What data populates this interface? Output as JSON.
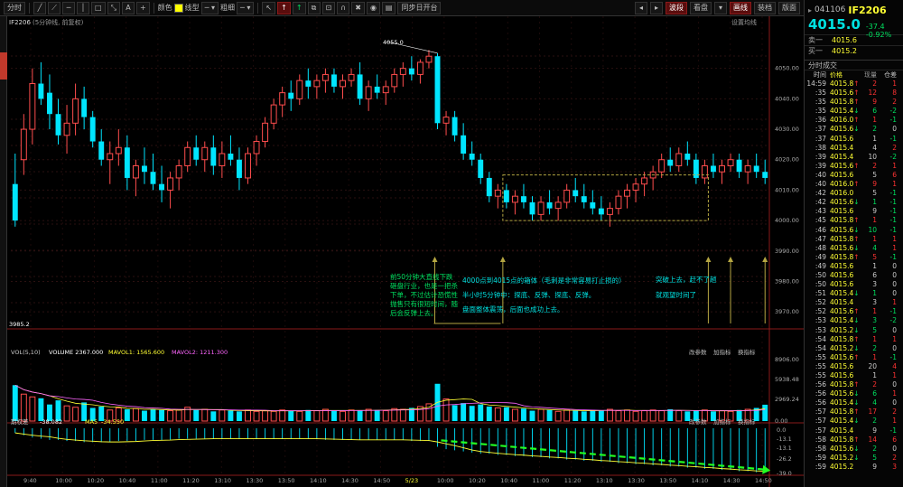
{
  "toolbar": {
    "time_btn": "分时",
    "color_label": "颜色",
    "line_label": "线型",
    "width_label": "粗细",
    "sync_label": "同步日开台",
    "cursor_btn": "↖",
    "up_btn": "↑",
    "arrow_btn": "↑",
    "wave_label": "波段",
    "board_label": "看盘",
    "draw_label": "画线",
    "layout_label": "装档",
    "more_label": "版面"
  },
  "chart": {
    "symbol_label": "IF2206",
    "period_label": "(5分钟线, 前复权)",
    "settings_label": "设置均线",
    "high_label": "4055.0",
    "low_label": "3985.2",
    "vol_header": "VOL(5,10)",
    "vol_value": "VOLUME 2367.000",
    "mavol1": "MAVOL1: 1565.600",
    "mavol2": "MAVOL2: 1211.300",
    "ind_header": "期权差",
    "ind_value": "-38.082",
    "ma_label": "MA5",
    "ma_value": "-34.550",
    "vol_mod": "改参数",
    "vol_add": "加指标",
    "vol_swap": "换指标",
    "ind_mod": "改参数",
    "ind_add": "加指标",
    "ind_swap": "换指标",
    "price_ticks": [
      "4050.00",
      "4040.00",
      "4030.00",
      "4020.00",
      "4010.00",
      "4000.00",
      "3990.00",
      "3980.00",
      "3970.00"
    ],
    "vol_ticks": [
      "8906.00",
      "5938.48",
      "2969.24",
      "0.00"
    ],
    "ind_ticks": [
      "0.0",
      "-13.1",
      "-13.1",
      "-26.2",
      "-39.0"
    ],
    "time_ticks": [
      "9:40",
      "10:00",
      "10:20",
      "10:40",
      "11:00",
      "11:20",
      "13:10",
      "13:30",
      "13:50",
      "14:10",
      "14:30",
      "14:50",
      "5/23",
      "10:00",
      "10:20",
      "10:40",
      "11:00",
      "11:20",
      "13:10",
      "13:30",
      "13:50",
      "14:10",
      "14:30",
      "14:50"
    ],
    "annotations": {
      "a1": "前50分钟大直线下跌砸盘行业，也是一把杀下单，不过估计恐慌性抛售只有很短时间，随后会反弹上去。",
      "a2_1": "4000点到4015点的箱体（毛刺是非常容易打止损的）",
      "a2_2": "半小时5分钟中：探底、反弹、探底、反弹。",
      "a2_3": "盘面整体震荡，后面也成功上去。",
      "a3_1": "突破上去，赶不了趟",
      "a3_2": "就观望时间了"
    }
  },
  "chart_data": {
    "type": "candlestick",
    "price_range": [
      3965,
      4060
    ],
    "candles": [
      [
        4012,
        4022,
        3998,
        4000
      ],
      [
        4020,
        4035,
        4015,
        4030
      ],
      [
        4030,
        4050,
        4025,
        4045
      ],
      [
        4045,
        4052,
        4038,
        4040
      ],
      [
        4042,
        4048,
        4030,
        4035
      ],
      [
        4035,
        4040,
        4025,
        4028
      ],
      [
        4028,
        4038,
        4022,
        4032
      ],
      [
        4032,
        4045,
        4028,
        4040
      ],
      [
        4040,
        4044,
        4030,
        4034
      ],
      [
        4034,
        4036,
        4024,
        4026
      ],
      [
        4026,
        4030,
        4018,
        4020
      ],
      [
        4020,
        4026,
        4012,
        4022
      ],
      [
        4022,
        4030,
        4018,
        4024
      ],
      [
        4024,
        4028,
        4010,
        4014
      ],
      [
        4014,
        4020,
        4008,
        4018
      ],
      [
        4018,
        4024,
        4012,
        4016
      ],
      [
        4016,
        4022,
        4010,
        4012
      ],
      [
        4012,
        4018,
        4006,
        4010
      ],
      [
        4010,
        4016,
        4004,
        4014
      ],
      [
        4014,
        4020,
        4010,
        4018
      ],
      [
        4018,
        4026,
        4016,
        4024
      ],
      [
        4024,
        4028,
        4018,
        4020
      ],
      [
        4020,
        4026,
        4016,
        4024
      ],
      [
        4024,
        4028,
        4015,
        4018
      ],
      [
        4018,
        4026,
        4014,
        4022
      ],
      [
        4022,
        4028,
        4018,
        4020
      ],
      [
        4020,
        4024,
        4010,
        4014
      ],
      [
        4014,
        4024,
        4012,
        4022
      ],
      [
        4022,
        4028,
        4018,
        4026
      ],
      [
        4026,
        4034,
        4024,
        4032
      ],
      [
        4032,
        4040,
        4030,
        4038
      ],
      [
        4038,
        4044,
        4034,
        4042
      ],
      [
        4042,
        4046,
        4036,
        4040
      ],
      [
        4040,
        4048,
        4038,
        4046
      ],
      [
        4046,
        4050,
        4040,
        4044
      ],
      [
        4044,
        4048,
        4040,
        4046
      ],
      [
        4046,
        4050,
        4042,
        4048
      ],
      [
        4048,
        4050,
        4042,
        4044
      ],
      [
        4044,
        4048,
        4040,
        4046
      ],
      [
        4046,
        4050,
        4044,
        4048
      ],
      [
        4048,
        4052,
        4038,
        4040
      ],
      [
        4040,
        4046,
        4036,
        4044
      ],
      [
        4044,
        4048,
        4040,
        4042
      ],
      [
        4042,
        4046,
        4038,
        4044
      ],
      [
        4044,
        4050,
        4042,
        4048
      ],
      [
        4048,
        4052,
        4044,
        4050
      ],
      [
        4050,
        4054,
        4046,
        4048
      ],
      [
        4048,
        4053,
        4045,
        4052
      ],
      [
        4052,
        4056,
        4050,
        4054
      ],
      [
        4054,
        4055,
        4030,
        4032
      ],
      [
        4032,
        4036,
        4028,
        4034
      ],
      [
        4034,
        4036,
        4026,
        4028
      ],
      [
        4028,
        4032,
        4020,
        4022
      ],
      [
        4022,
        4026,
        4018,
        4020
      ],
      [
        4020,
        4022,
        4012,
        4014
      ],
      [
        4014,
        4016,
        4006,
        4008
      ],
      [
        4008,
        4012,
        4004,
        4010
      ],
      [
        4010,
        4012,
        4004,
        4006
      ],
      [
        4006,
        4010,
        4002,
        4008
      ],
      [
        4008,
        4012,
        4004,
        4006
      ],
      [
        4006,
        4008,
        4000,
        4002
      ],
      [
        4002,
        4008,
        4000,
        4006
      ],
      [
        4006,
        4010,
        4002,
        4004
      ],
      [
        4004,
        4008,
        4000,
        4006
      ],
      [
        4006,
        4012,
        4004,
        4010
      ],
      [
        4010,
        4014,
        4006,
        4008
      ],
      [
        4008,
        4012,
        4004,
        4006
      ],
      [
        4006,
        4010,
        4002,
        4004
      ],
      [
        4004,
        4008,
        4000,
        4002
      ],
      [
        4002,
        4006,
        3998,
        4004
      ],
      [
        4004,
        4010,
        4002,
        4008
      ],
      [
        4008,
        4012,
        4004,
        4010
      ],
      [
        4010,
        4014,
        4006,
        4012
      ],
      [
        4012,
        4016,
        4008,
        4014
      ],
      [
        4014,
        4018,
        4010,
        4016
      ],
      [
        4016,
        4022,
        4014,
        4020
      ],
      [
        4020,
        4024,
        4016,
        4018
      ],
      [
        4018,
        4024,
        4016,
        4022
      ],
      [
        4022,
        4026,
        4018,
        4020
      ],
      [
        4020,
        4022,
        4012,
        4014
      ],
      [
        4014,
        4020,
        4012,
        4018
      ],
      [
        4018,
        4022,
        4014,
        4016
      ],
      [
        4016,
        4020,
        4012,
        4018
      ],
      [
        4018,
        4022,
        4016,
        4020
      ],
      [
        4020,
        4022,
        4014,
        4016
      ],
      [
        4016,
        4020,
        4012,
        4018
      ],
      [
        4018,
        4022,
        4014,
        4016
      ],
      [
        4016,
        4020,
        4012,
        4014
      ]
    ],
    "volume": [
      5200,
      3900,
      3500,
      3300,
      2400,
      3000,
      2200,
      2000,
      2700,
      1900,
      2100,
      1600,
      1900,
      1700,
      1800,
      1500,
      1700,
      1600,
      1500,
      1600,
      2000,
      1600,
      1700,
      1400,
      1600,
      1500,
      1400,
      1600,
      1400,
      1500,
      1400,
      1600,
      1500,
      1400,
      1600,
      1500,
      1700,
      1500,
      1400,
      1600,
      1500,
      1700,
      1600,
      1500,
      1800,
      1700,
      1900,
      2100,
      2500,
      5400,
      3200,
      2300,
      2600,
      2200,
      2400,
      2100,
      1900,
      2000,
      1700,
      1800,
      1500,
      1700,
      1600,
      1400,
      1600,
      1500,
      1400,
      1600,
      1500,
      1700,
      1500,
      1600,
      1400,
      1500,
      1600,
      1500,
      1700,
      1500,
      1400,
      1500,
      1600,
      1400,
      1500,
      1400,
      1600,
      1700,
      1900,
      2367
    ],
    "indicator": [
      -4,
      -6,
      -8,
      -9,
      -10,
      -10,
      -11,
      -11,
      -12,
      -12,
      -12,
      -12,
      -11,
      -11,
      -11,
      -10,
      -10,
      -10,
      -10,
      -9,
      -9,
      -9,
      -9,
      -9,
      -9,
      -9,
      -9,
      -9,
      -9,
      -9,
      -9,
      -9,
      -9,
      -9,
      -9,
      -9,
      -10,
      -10,
      -10,
      -10,
      -10,
      -10,
      -10,
      -10,
      -10,
      -10,
      -11,
      -11,
      -11,
      -16,
      -18,
      -19,
      -20,
      -21,
      -22,
      -22,
      -23,
      -23,
      -24,
      -24,
      -25,
      -25,
      -26,
      -26,
      -27,
      -27,
      -28,
      -28,
      -29,
      -29,
      -30,
      -30,
      -31,
      -31,
      -32,
      -32,
      -33,
      -33,
      -34,
      -34,
      -35,
      -35,
      -36,
      -36,
      -37,
      -37,
      -38,
      -38
    ]
  },
  "quote": {
    "code": "041106",
    "name": "IF2206",
    "last": "4015.0",
    "change": "-37.4",
    "pct": "-0.92%",
    "sell_label": "卖一",
    "sell_price": "4015.6",
    "buy_label": "买一",
    "buy_price": "4015.2",
    "section_title": "分时成交",
    "head_time": "时间",
    "head_price": "价格",
    "head_vol": "现量",
    "head_oi": "仓差"
  },
  "trades": [
    {
      "t": "14:59",
      "p": "4015.8",
      "d": "↑",
      "v": "2",
      "o": "1"
    },
    {
      "t": ":35",
      "p": "4015.6",
      "d": "↑",
      "v": "12",
      "o": "8"
    },
    {
      "t": ":35",
      "p": "4015.8",
      "d": "↑",
      "v": "9",
      "o": "2"
    },
    {
      "t": ":35",
      "p": "4015.4",
      "d": "↓",
      "v": "6",
      "o": "-2"
    },
    {
      "t": ":36",
      "p": "4016.0",
      "d": "↑",
      "v": "1",
      "o": "-1"
    },
    {
      "t": ":37",
      "p": "4015.6",
      "d": "↓",
      "v": "2",
      "o": "0"
    },
    {
      "t": ":37",
      "p": "4015.6",
      "d": "",
      "v": "1",
      "o": "-1"
    },
    {
      "t": ":38",
      "p": "4015.4",
      "d": "",
      "v": "4",
      "o": "2"
    },
    {
      "t": ":39",
      "p": "4015.4",
      "d": "",
      "v": "10",
      "o": "-2"
    },
    {
      "t": ":39",
      "p": "4015.6",
      "d": "↑",
      "v": "2",
      "o": "1"
    },
    {
      "t": ":40",
      "p": "4015.6",
      "d": "",
      "v": "5",
      "o": "6"
    },
    {
      "t": ":40",
      "p": "4016.0",
      "d": "↑",
      "v": "9",
      "o": "1"
    },
    {
      "t": ":42",
      "p": "4016.0",
      "d": "",
      "v": "5",
      "o": "-1"
    },
    {
      "t": ":42",
      "p": "4015.6",
      "d": "↓",
      "v": "1",
      "o": "-1"
    },
    {
      "t": ":43",
      "p": "4015.6",
      "d": "",
      "v": "9",
      "o": "-1"
    },
    {
      "t": ":45",
      "p": "4015.8",
      "d": "↑",
      "v": "1",
      "o": "-1"
    },
    {
      "t": ":46",
      "p": "4015.6",
      "d": "↓",
      "v": "10",
      "o": "-1"
    },
    {
      "t": ":47",
      "p": "4015.8",
      "d": "↑",
      "v": "1",
      "o": "1"
    },
    {
      "t": ":48",
      "p": "4015.6",
      "d": "↓",
      "v": "4",
      "o": "1"
    },
    {
      "t": ":49",
      "p": "4015.8",
      "d": "↑",
      "v": "5",
      "o": "-1"
    },
    {
      "t": ":49",
      "p": "4015.6",
      "d": "",
      "v": "1",
      "o": "0"
    },
    {
      "t": ":50",
      "p": "4015.6",
      "d": "",
      "v": "6",
      "o": "0"
    },
    {
      "t": ":50",
      "p": "4015.6",
      "d": "",
      "v": "3",
      "o": "0"
    },
    {
      "t": ":51",
      "p": "4015.4",
      "d": "↓",
      "v": "1",
      "o": "0"
    },
    {
      "t": ":52",
      "p": "4015.4",
      "d": "",
      "v": "3",
      "o": "1"
    },
    {
      "t": ":52",
      "p": "4015.6",
      "d": "↑",
      "v": "1",
      "o": "-1"
    },
    {
      "t": ":53",
      "p": "4015.4",
      "d": "↓",
      "v": "3",
      "o": "-2"
    },
    {
      "t": ":53",
      "p": "4015.2",
      "d": "↓",
      "v": "5",
      "o": "0"
    },
    {
      "t": ":54",
      "p": "4015.8",
      "d": "↑",
      "v": "1",
      "o": "1"
    },
    {
      "t": ":54",
      "p": "4015.2",
      "d": "↓",
      "v": "2",
      "o": "0"
    },
    {
      "t": ":55",
      "p": "4015.6",
      "d": "↑",
      "v": "1",
      "o": "-1"
    },
    {
      "t": ":55",
      "p": "4015.6",
      "d": "",
      "v": "20",
      "o": "4"
    },
    {
      "t": ":55",
      "p": "4015.6",
      "d": "",
      "v": "1",
      "o": "1"
    },
    {
      "t": ":56",
      "p": "4015.8",
      "d": "↑",
      "v": "2",
      "o": "0"
    },
    {
      "t": ":56",
      "p": "4015.6",
      "d": "↓",
      "v": "6",
      "o": "1"
    },
    {
      "t": ":56",
      "p": "4015.4",
      "d": "↓",
      "v": "4",
      "o": "0"
    },
    {
      "t": ":57",
      "p": "4015.8",
      "d": "↑",
      "v": "17",
      "o": "2"
    },
    {
      "t": ":57",
      "p": "4015.4",
      "d": "↓",
      "v": "2",
      "o": "1"
    },
    {
      "t": ":57",
      "p": "4015.4",
      "d": "",
      "v": "9",
      "o": "-1"
    },
    {
      "t": ":58",
      "p": "4015.8",
      "d": "↑",
      "v": "14",
      "o": "6"
    },
    {
      "t": ":58",
      "p": "4015.6",
      "d": "↓",
      "v": "2",
      "o": "0"
    },
    {
      "t": ":59",
      "p": "4015.2",
      "d": "↓",
      "v": "5",
      "o": "2"
    },
    {
      "t": ":59",
      "p": "4015.2",
      "d": "",
      "v": "9",
      "o": "3"
    }
  ]
}
